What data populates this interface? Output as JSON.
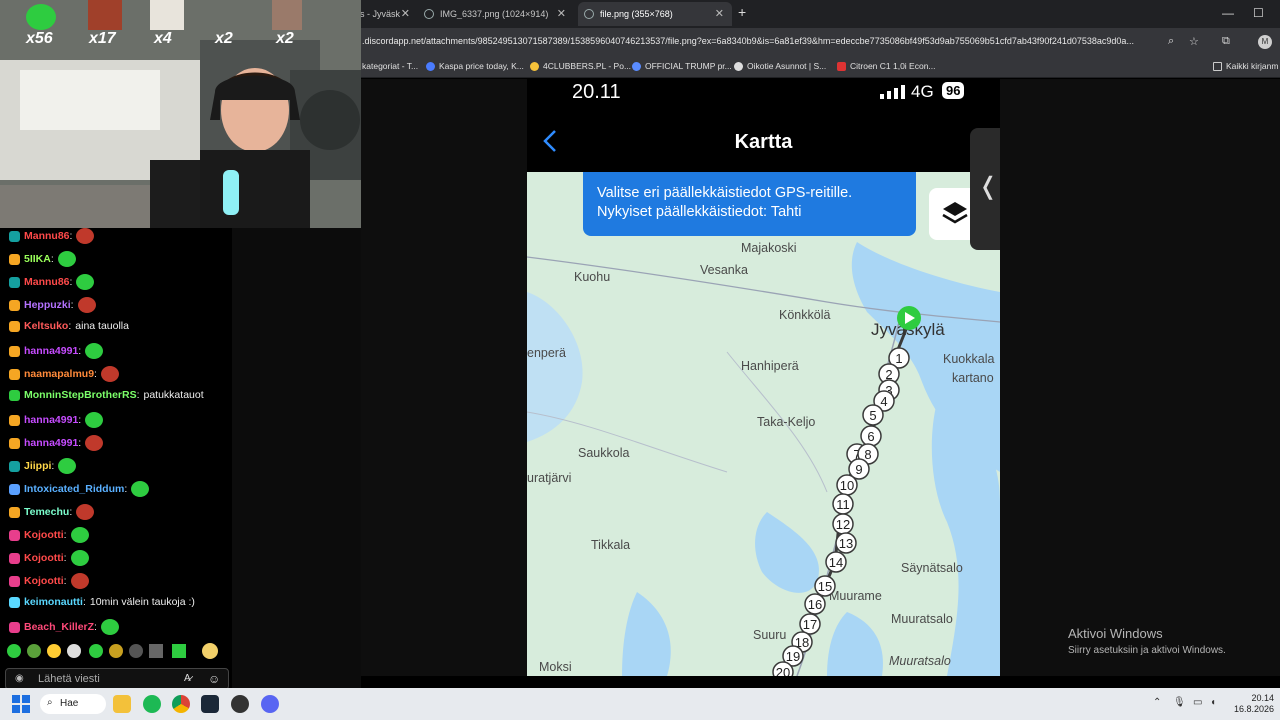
{
  "browser": {
    "tabs": [
      {
        "title": "lä, Matkakeskus - Jyväsk",
        "active": false
      },
      {
        "title": "IMG_6337.png (1024×914)",
        "active": false
      },
      {
        "title": "file.png (355×768)",
        "active": true
      }
    ],
    "url": ".discordapp.net/attachments/985249513071587389/1538596040746213537/file.png?ex=6a8340b9&is=6a81ef39&hm=edeccbe7735086bf49f53d9ab755069b51cfd7ab43f90f241d07538ac9d0a...",
    "bookmarks": [
      "kategoriat - T...",
      "Kaspa price today, K...",
      "4CLUBBERS.PL - Po...",
      "OFFICIAL TRUMP pr...",
      "Oikotie Asunnot | S...",
      "Citroen C1 1,0i Econ...",
      "Kaikki kirjanm"
    ]
  },
  "phone": {
    "time": "20.11",
    "network": "4G",
    "battery": "96",
    "title": "Kartta",
    "tooltip_line1": "Valitse eri päällekkäistiedot GPS-reitille.",
    "tooltip_line2": "Nykyiset päällekkäistiedot: Tahti"
  },
  "map": {
    "places": [
      "Majakoski",
      "Kuohu",
      "Vesanka",
      "Könkkölä",
      "Jyväskylä",
      "Kuokkala",
      "kartano",
      "enperä",
      "Hanhiperä",
      "Taka-Keljo",
      "Saukkola",
      "uratjärvi",
      "Tikkala",
      "Säynätsalo",
      "Muuratsalo",
      "Muuratsalo",
      "Suuru",
      "Moksi",
      "Muurame"
    ],
    "route_points": [
      "1",
      "2",
      "3",
      "4",
      "5",
      "6",
      "7",
      "8",
      "9",
      "10",
      "11",
      "12",
      "13",
      "14",
      "15",
      "16",
      "17",
      "18",
      "19",
      "20"
    ]
  },
  "stream": {
    "emote_counters": [
      "x56",
      "x17",
      "x4",
      "x2",
      "x2"
    ],
    "chat": [
      {
        "user": "Mannu86",
        "text": "",
        "color": "#ff4a4a"
      },
      {
        "user": "5IIKA",
        "text": "",
        "color": "#9aff5a"
      },
      {
        "user": "Mannu86",
        "text": "",
        "color": "#ff4a4a"
      },
      {
        "user": "Heppuzki",
        "text": "",
        "color": "#b472ff"
      },
      {
        "user": "Keltsuko",
        "text": "aina tauolla",
        "color": "#ff5a5a"
      },
      {
        "user": "hanna4991",
        "text": "",
        "color": "#c64cff"
      },
      {
        "user": "naamapalmu9",
        "text": "",
        "color": "#ff8a3a"
      },
      {
        "user": "MonninStepBrotherRS",
        "text": "patukkatauot",
        "color": "#7cff6a"
      },
      {
        "user": "hanna4991",
        "text": "",
        "color": "#c64cff"
      },
      {
        "user": "hanna4991",
        "text": "",
        "color": "#c64cff"
      },
      {
        "user": "Jiippi",
        "text": "",
        "color": "#ffd84a"
      },
      {
        "user": "Intoxicated_Riddum",
        "text": "",
        "color": "#5ab0ff"
      },
      {
        "user": "Temechu",
        "text": "",
        "color": "#7cffce"
      },
      {
        "user": "Kojootti",
        "text": "",
        "color": "#ff4a4a"
      },
      {
        "user": "Kojootti",
        "text": "",
        "color": "#ff4a4a"
      },
      {
        "user": "Kojootti",
        "text": "",
        "color": "#ff4a4a"
      },
      {
        "user": "keimonautti",
        "text": "10min välein taukoja :)",
        "color": "#5ad8ff"
      },
      {
        "user": "Beach_KillerZ",
        "text": "",
        "color": "#ff4a7a"
      }
    ],
    "chat_placeholder": "Lähetä viesti"
  },
  "windows": {
    "activate_title": "Aktivoi Windows",
    "activate_sub": "Siirry asetuksiin ja aktivoi Windows.",
    "search_label": "Hae",
    "clock_time": "20.14",
    "clock_date": "16.8.2026"
  }
}
